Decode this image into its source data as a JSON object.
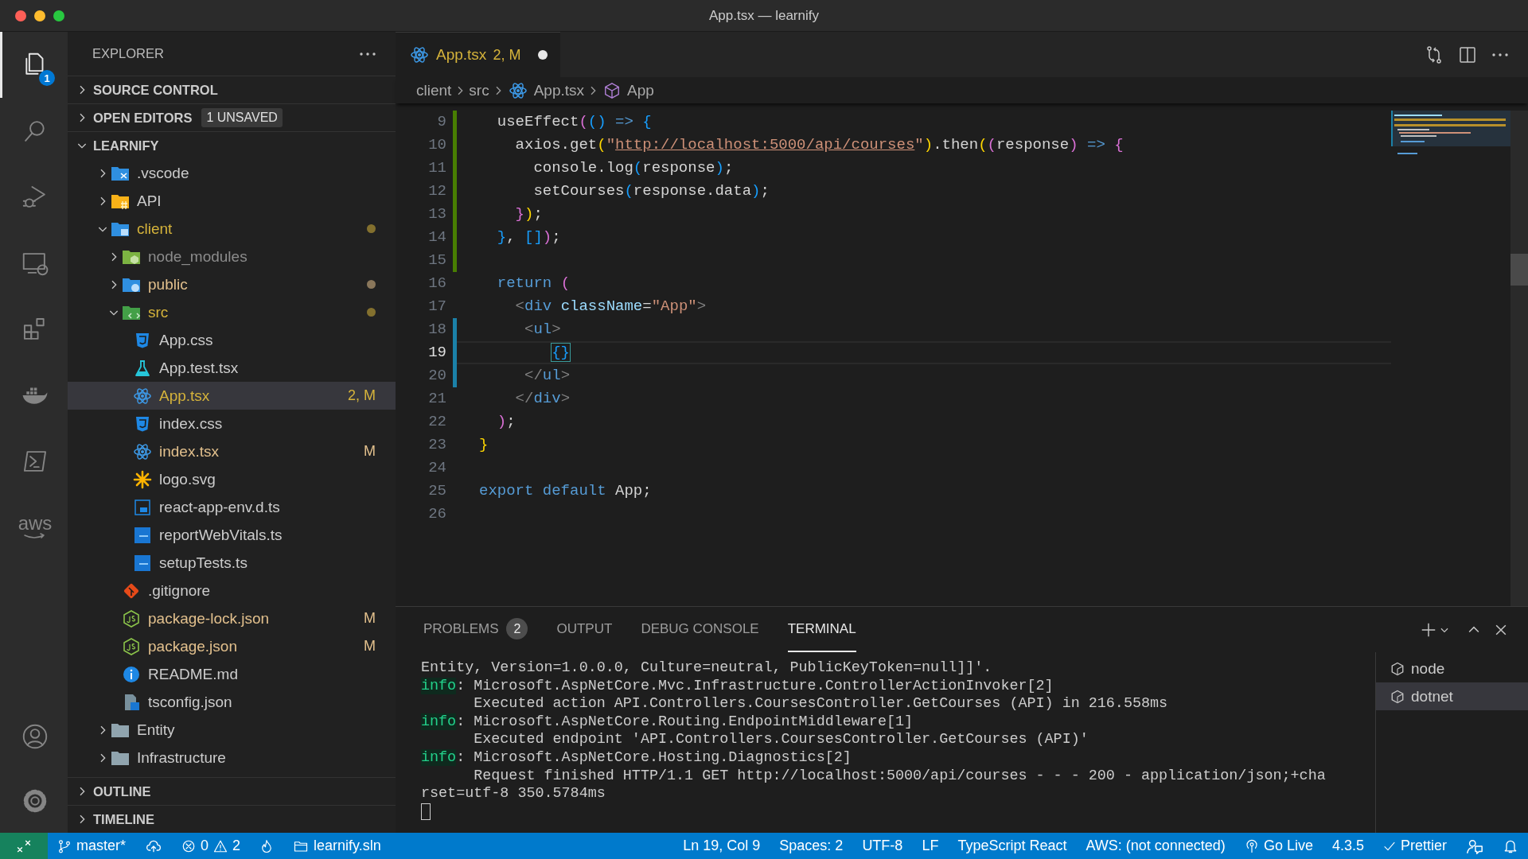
{
  "window": {
    "title": "App.tsx — learnify"
  },
  "activity_bar": {
    "top": [
      {
        "kind": "files",
        "selected": true,
        "badge": "1"
      },
      {
        "kind": "search",
        "selected": false
      },
      {
        "kind": "debug",
        "selected": false
      },
      {
        "kind": "remote",
        "selected": false
      },
      {
        "kind": "extensions",
        "selected": false
      },
      {
        "kind": "docker",
        "selected": false
      },
      {
        "kind": "terminal",
        "selected": false
      },
      {
        "kind": "aws",
        "selected": false,
        "label": "aws"
      }
    ],
    "bottom": [
      {
        "kind": "account",
        "selected": false
      },
      {
        "kind": "settings",
        "selected": false
      }
    ]
  },
  "explorer": {
    "title": "EXPLORER",
    "sections_top": [
      {
        "title": "SOURCE CONTROL",
        "expanded": false
      },
      {
        "title": "OPEN EDITORS",
        "expanded": false,
        "badge": "1 UNSAVED"
      }
    ],
    "project": {
      "title": "LEARNIFY",
      "expanded": true
    },
    "tree": [
      {
        "name": ".vscode",
        "kind": "folder-vscode",
        "expanded": false,
        "color": "#cccccc",
        "selected": false
      },
      {
        "name": "API",
        "kind": "folder-csharp",
        "expanded": false,
        "color": "#cccccc",
        "selected": false
      },
      {
        "name": "client",
        "kind": "folder-client",
        "expanded": true,
        "color": "#d5b33b",
        "dot": true,
        "selected": false,
        "children": [
          {
            "name": "node_modules",
            "kind": "folder-node",
            "expanded": false,
            "color": "#8c8c8c",
            "selected": false
          },
          {
            "name": "public",
            "kind": "folder-public",
            "expanded": false,
            "color": "#e2c08d",
            "dot": true,
            "selected": false
          },
          {
            "name": "src",
            "kind": "folder-src",
            "expanded": true,
            "color": "#d5b33b",
            "dot": true,
            "selected": false,
            "children": [
              {
                "name": "App.css",
                "kind": "css",
                "color": "#cccccc",
                "selected": false
              },
              {
                "name": "App.test.tsx",
                "kind": "test",
                "color": "#cccccc",
                "selected": false
              },
              {
                "name": "App.tsx",
                "kind": "react",
                "color": "#d5b33b",
                "badge": "2, M",
                "selected": true
              },
              {
                "name": "index.css",
                "kind": "css",
                "color": "#cccccc",
                "selected": false
              },
              {
                "name": "index.tsx",
                "kind": "react",
                "color": "#e2c08d",
                "badge": "M",
                "selected": false
              },
              {
                "name": "logo.svg",
                "kind": "svg",
                "color": "#cccccc",
                "selected": false
              },
              {
                "name": "react-app-env.d.ts",
                "kind": "ts-outline",
                "color": "#cccccc",
                "selected": false
              },
              {
                "name": "reportWebVitals.ts",
                "kind": "ts",
                "color": "#cccccc",
                "selected": false
              },
              {
                "name": "setupTests.ts",
                "kind": "ts",
                "color": "#cccccc",
                "selected": false
              }
            ]
          },
          {
            "name": ".gitignore",
            "kind": "git",
            "color": "#cccccc",
            "selected": false
          },
          {
            "name": "package-lock.json",
            "kind": "node",
            "color": "#e2c08d",
            "badge": "M",
            "selected": false
          },
          {
            "name": "package.json",
            "kind": "node",
            "color": "#e2c08d",
            "badge": "M",
            "selected": false
          },
          {
            "name": "README.md",
            "kind": "info",
            "color": "#cccccc",
            "selected": false
          },
          {
            "name": "tsconfig.json",
            "kind": "tsconfig",
            "color": "#cccccc",
            "selected": false
          }
        ]
      },
      {
        "name": "Entity",
        "kind": "folder",
        "expanded": false,
        "color": "#cccccc",
        "selected": false
      },
      {
        "name": "Infrastructure",
        "kind": "folder",
        "expanded": false,
        "color": "#cccccc",
        "selected": false
      }
    ],
    "sections_bottom": [
      {
        "title": "OUTLINE",
        "expanded": false
      },
      {
        "title": "TIMELINE",
        "expanded": false
      }
    ]
  },
  "editor": {
    "tabs": [
      {
        "label": "App.tsx",
        "status": "2, M",
        "dirty": true,
        "selected": true
      }
    ],
    "breadcrumbs": [
      {
        "text": "client",
        "kind": "folder"
      },
      {
        "text": "src",
        "kind": "folder"
      },
      {
        "text": "App.tsx",
        "kind": "react"
      },
      {
        "text": "App",
        "kind": "symbol"
      }
    ],
    "lines": [
      {
        "number": "9",
        "color": "#487e02",
        "tokens": [
          {
            "text": "  useEffect",
            "kind": "plain"
          },
          {
            "text": "(",
            "kind": "bracket2"
          },
          {
            "text": "()",
            "kind": "bracket3"
          },
          {
            "text": " => ",
            "kind": "keyword"
          },
          {
            "text": "{",
            "kind": "bracket3"
          }
        ]
      },
      {
        "number": "10",
        "color": "#487e02",
        "tokens": [
          {
            "text": "    axios.get",
            "kind": "plain"
          },
          {
            "text": "(",
            "kind": "bracket1"
          },
          {
            "text": "\"",
            "kind": "string"
          },
          {
            "text": "http://localhost:5000/api/courses",
            "kind": "link"
          },
          {
            "text": "\"",
            "kind": "string"
          },
          {
            "text": ")",
            "kind": "bracket1"
          },
          {
            "text": ".then",
            "kind": "plain"
          },
          {
            "text": "(",
            "kind": "bracket1"
          },
          {
            "text": "(",
            "kind": "bracket2"
          },
          {
            "text": "response",
            "kind": "plain"
          },
          {
            "text": ")",
            "kind": "bracket2"
          },
          {
            "text": " => ",
            "kind": "keyword"
          },
          {
            "text": "{",
            "kind": "bracket2"
          }
        ]
      },
      {
        "number": "11",
        "color": "#487e02",
        "tokens": [
          {
            "text": "      console.log",
            "kind": "plain"
          },
          {
            "text": "(",
            "kind": "bracket3"
          },
          {
            "text": "response",
            "kind": "plain"
          },
          {
            "text": ")",
            "kind": "bracket3"
          },
          {
            "text": ";",
            "kind": "plain"
          }
        ]
      },
      {
        "number": "12",
        "color": "#487e02",
        "tokens": [
          {
            "text": "      setCourses",
            "kind": "plain"
          },
          {
            "text": "(",
            "kind": "bracket3"
          },
          {
            "text": "response.data",
            "kind": "plain"
          },
          {
            "text": ")",
            "kind": "bracket3"
          },
          {
            "text": ";",
            "kind": "plain"
          }
        ]
      },
      {
        "number": "13",
        "color": "#487e02",
        "tokens": [
          {
            "text": "    }",
            "kind": "bracket2"
          },
          {
            "text": ")",
            "kind": "bracket1"
          },
          {
            "text": ";",
            "kind": "plain"
          }
        ]
      },
      {
        "number": "14",
        "color": "#487e02",
        "tokens": [
          {
            "text": "  }",
            "kind": "bracket3"
          },
          {
            "text": ", ",
            "kind": "plain"
          },
          {
            "text": "[]",
            "kind": "bracket3"
          },
          {
            "text": ")",
            "kind": "bracket2"
          },
          {
            "text": ";",
            "kind": "plain"
          }
        ]
      },
      {
        "number": "15",
        "color": "#487e02"
      },
      {
        "number": "16",
        "tokens": [
          {
            "text": "  return ",
            "kind": "keyword"
          },
          {
            "text": "(",
            "kind": "bracket2"
          }
        ]
      },
      {
        "number": "17",
        "tokens": [
          {
            "text": "    <",
            "kind": "punct"
          },
          {
            "text": "div",
            "kind": "tag"
          },
          {
            "text": " className",
            "kind": "attr"
          },
          {
            "text": "=",
            "kind": "plain"
          },
          {
            "text": "\"App\"",
            "kind": "string"
          },
          {
            "text": ">",
            "kind": "punct"
          }
        ]
      },
      {
        "number": "18",
        "color": "#1b81a8",
        "tokens": [
          {
            "text": "     <",
            "kind": "punct"
          },
          {
            "text": "ul",
            "kind": "tag"
          },
          {
            "text": ">",
            "kind": "punct"
          }
        ]
      },
      {
        "number": "19",
        "color": "#1b81a8",
        "current": true,
        "tokens": [
          {
            "text": "        {}",
            "kind": "match"
          }
        ]
      },
      {
        "number": "20",
        "color": "#1b81a8",
        "tokens": [
          {
            "text": "     </",
            "kind": "punct"
          },
          {
            "text": "ul",
            "kind": "tag"
          },
          {
            "text": ">",
            "kind": "punct"
          }
        ]
      },
      {
        "number": "21",
        "tokens": [
          {
            "text": "    </",
            "kind": "punct"
          },
          {
            "text": "div",
            "kind": "tag"
          },
          {
            "text": ">",
            "kind": "punct"
          }
        ]
      },
      {
        "number": "22",
        "tokens": [
          {
            "text": "  )",
            "kind": "bracket2"
          },
          {
            "text": ";",
            "kind": "plain"
          }
        ]
      },
      {
        "number": "23",
        "tokens": [
          {
            "text": "}",
            "kind": "bracket1"
          }
        ]
      },
      {
        "number": "24"
      },
      {
        "number": "25",
        "tokens": [
          {
            "text": "export default",
            "kind": "keyword"
          },
          {
            "text": " App;",
            "kind": "plain"
          }
        ]
      },
      {
        "number": "26"
      }
    ]
  },
  "panel": {
    "tabs": [
      {
        "label": "PROBLEMS",
        "badge": "2",
        "selected": false
      },
      {
        "label": "OUTPUT",
        "selected": false
      },
      {
        "label": "DEBUG CONSOLE",
        "selected": false
      },
      {
        "label": "TERMINAL",
        "selected": true
      }
    ],
    "terminal_lines": [
      {
        "text": "Entity, Version=1.0.0.0, Culture=neutral, PublicKeyToken=null]]'."
      },
      {
        "prefix": "info",
        "text": ": Microsoft.AspNetCore.Mvc.Infrastructure.ControllerActionInvoker[2]"
      },
      {
        "text": "      Executed action API.Controllers.CoursesController.GetCourses (API) in 216.558ms"
      },
      {
        "prefix": "info",
        "text": ": Microsoft.AspNetCore.Routing.EndpointMiddleware[1]"
      },
      {
        "text": "      Executed endpoint 'API.Controllers.CoursesController.GetCourses (API)'"
      },
      {
        "prefix": "info",
        "text": ": Microsoft.AspNetCore.Hosting.Diagnostics[2]"
      },
      {
        "text": "      Request finished HTTP/1.1 GET http://localhost:5000/api/courses - - - 200 - application/json;+cha"
      },
      {
        "text": "rset=utf-8 350.5784ms"
      }
    ],
    "sessions": [
      {
        "name": "node",
        "selected": false
      },
      {
        "name": "dotnet",
        "selected": true
      }
    ]
  },
  "status_bar": {
    "left": [
      {
        "kind": "remote"
      },
      {
        "kind": "branch",
        "text": "master*"
      },
      {
        "kind": "sync"
      },
      {
        "kind": "problems",
        "errors": "0",
        "warnings": "2"
      },
      {
        "kind": "flame"
      },
      {
        "kind": "folder",
        "text": "learnify.sln"
      }
    ],
    "right": [
      {
        "kind": "text",
        "text": "Ln 19, Col 9"
      },
      {
        "kind": "text",
        "text": "Spaces: 2"
      },
      {
        "kind": "text",
        "text": "UTF-8"
      },
      {
        "kind": "text",
        "text": "LF"
      },
      {
        "kind": "text",
        "text": "TypeScript React"
      },
      {
        "kind": "text",
        "text": "AWS: (not connected)"
      },
      {
        "kind": "broadcast",
        "text": "Go Live"
      },
      {
        "kind": "text",
        "text": "4.3.5"
      },
      {
        "kind": "check",
        "text": "Prettier"
      },
      {
        "kind": "feedback"
      },
      {
        "kind": "bell"
      }
    ]
  }
}
